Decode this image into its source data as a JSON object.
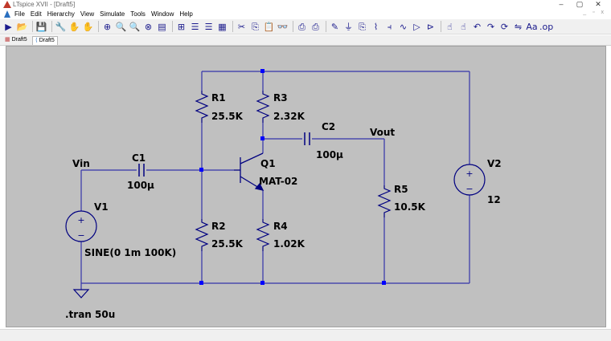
{
  "window": {
    "title": "LTspice XVII - [Draft5]",
    "minimize": "–",
    "maximize": "▢",
    "close": "✕"
  },
  "menu": {
    "items": [
      "File",
      "Edit",
      "Hierarchy",
      "View",
      "Simulate",
      "Tools",
      "Window",
      "Help"
    ],
    "mdi_controls": "_ ▫ x"
  },
  "toolbar": {
    "icons": [
      "run-icon",
      "open-icon",
      "save-icon",
      "control-panel-icon",
      "halt-icon",
      "pan-icon",
      "zoom-in-icon",
      "zoom-out-icon",
      "zoom-fit-icon",
      "cancel-zoom-icon",
      "autorange-icon",
      "grid-icon",
      "tile-horizontal-icon",
      "tile-vertical-icon",
      "cascade-icon",
      "cut-icon",
      "copy-icon",
      "paste-icon",
      "find-icon",
      "print-icon",
      "print-setup-icon",
      "wire-icon",
      "ground-icon",
      "label-net-icon",
      "resistor-icon",
      "capacitor-icon",
      "inductor-icon",
      "diode-icon",
      "component-icon",
      "move-icon",
      "drag-icon",
      "undo-icon",
      "redo-icon",
      "rotate-icon",
      "mirror-icon",
      "text-icon",
      "spice-directive-icon"
    ],
    "glyphs": [
      "▶",
      "📂",
      "💾",
      "🔧",
      "✋",
      "✋",
      "⊕",
      "🔍",
      "🔍",
      "⊗",
      "▤",
      "⊞",
      "☰",
      "☰",
      "▦",
      "✂",
      "⎘",
      "📋",
      "👓",
      "⎙",
      "⎙",
      "✎",
      "⏚",
      "⎘",
      "⌇",
      "⫞",
      "∿",
      "▷",
      "⊳",
      "☝",
      "☝",
      "↶",
      "↷",
      "⟳",
      "⇋",
      "Aa",
      ".op"
    ]
  },
  "tabs": [
    {
      "label": "Draft5",
      "icon": "schematic-icon",
      "active": false
    },
    {
      "label": "Draft5",
      "icon": "waveform-icon",
      "active": true
    }
  ],
  "schematic": {
    "wire_color": "#3333aa",
    "component_color": "#000080",
    "node_color": "#0000ff",
    "labels": {
      "r1": "R1",
      "r1_val": "25.5K",
      "r2": "R2",
      "r2_val": "25.5K",
      "r3": "R3",
      "r3_val": "2.32K",
      "r4": "R4",
      "r4_val": "1.02K",
      "r5": "R5",
      "r5_val": "10.5K",
      "c1": "C1",
      "c1_val": "100µ",
      "c2": "C2",
      "c2_val": "100µ",
      "q1": "Q1",
      "q1_val": "MAT-02",
      "v1": "V1",
      "v1_val": "SINE(0 1m 100K)",
      "v2": "V2",
      "v2_val": "12",
      "vin": "Vin",
      "vout": "Vout",
      "directive": ".tran 50u",
      "plus": "+",
      "minus": "−"
    }
  }
}
